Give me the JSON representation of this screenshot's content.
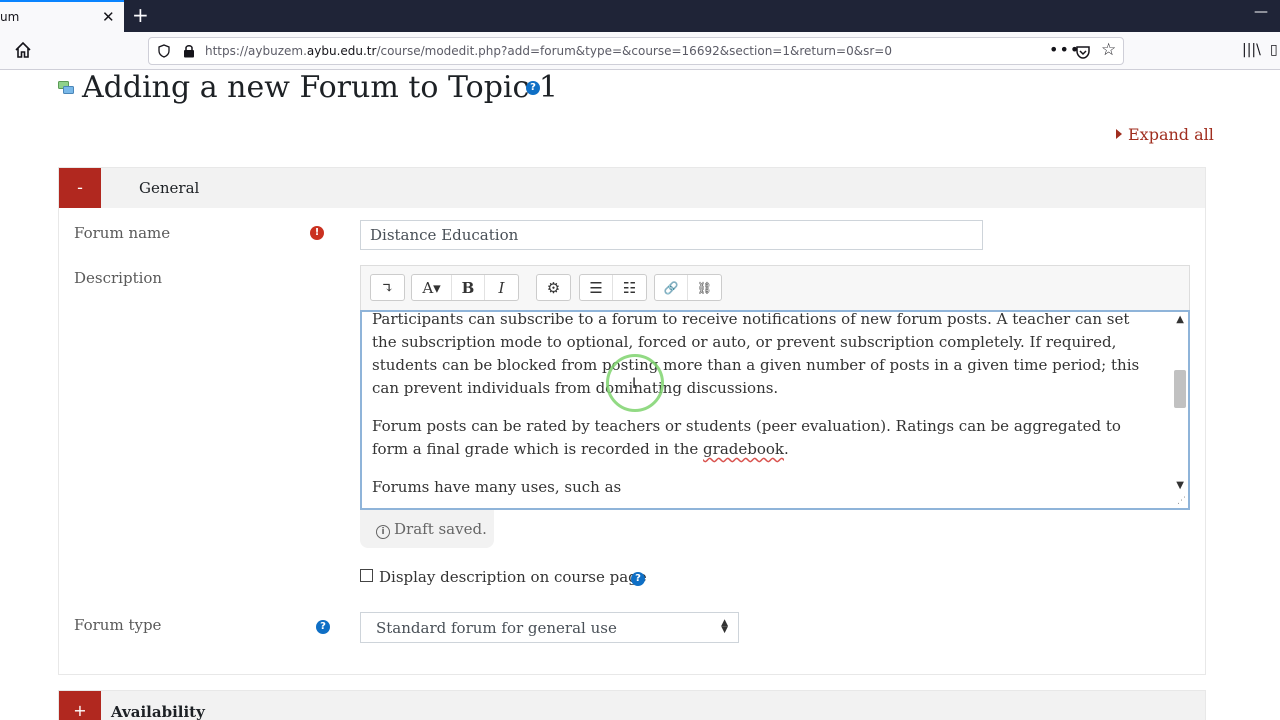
{
  "browser": {
    "tab_title": "um",
    "close_symbol": "✕",
    "new_tab_symbol": "+",
    "minimize_symbol": "—",
    "url_prefix": "https://aybuzem.",
    "url_domain": "aybu.edu.tr",
    "url_path": "/course/modedit.php?add=forum&type=&course=16692&section=1&return=0&sr=0",
    "more_symbol": "•••",
    "star_symbol": "☆",
    "library_symbol": "|||\\",
    "sidebar_symbol": "▯"
  },
  "page": {
    "title": "Adding a new Forum to Topic 1",
    "help_symbol": "?",
    "expand_all": "Expand all"
  },
  "general": {
    "toggle": "-",
    "title": "General",
    "forum_name_label": "Forum name",
    "required_symbol": "!",
    "forum_name_value": "Distance Education",
    "description_label": "Description",
    "toolbar": {
      "collapse": "↴",
      "font": "A▾",
      "bold": "B",
      "italic": "I",
      "settings": "⚙",
      "unordered_list": "☰",
      "ordered_list": "☷",
      "link": "🔗",
      "unlink": "⛓"
    },
    "description_paragraphs": [
      "Participants can subscribe to a forum to receive notifications of new forum posts. A teacher can set the subscription mode to optional, forced or auto, or prevent subscription completely. If required, students can be blocked from posting more than a given number of posts in a given time period; this can prevent individuals from dominating discussions.",
      "Forum posts can be rated by teachers or students (peer evaluation). Ratings can be aggregated to form a final grade which is recorded in the ",
      "Forums have many uses, such as"
    ],
    "gradebook_word": "gradebook",
    "period": ".",
    "draft_saved": "Draft saved.",
    "info_symbol": "i",
    "display_description_label": "Display description on course page",
    "forum_type_label": "Forum type",
    "forum_type_value": "Standard forum for general use",
    "scroll_up": "▲",
    "scroll_down": "▼",
    "resize_symbol": "⋰",
    "ibeam_symbol": "I"
  },
  "availability": {
    "toggle": "+",
    "title": "Availability"
  },
  "colors": {
    "accent_red": "#b1281f",
    "link_red": "#a02e1f",
    "help_blue": "#0f6fc5",
    "focus_blue": "#8fb4d9",
    "cursor_green": "#7fd36f"
  }
}
